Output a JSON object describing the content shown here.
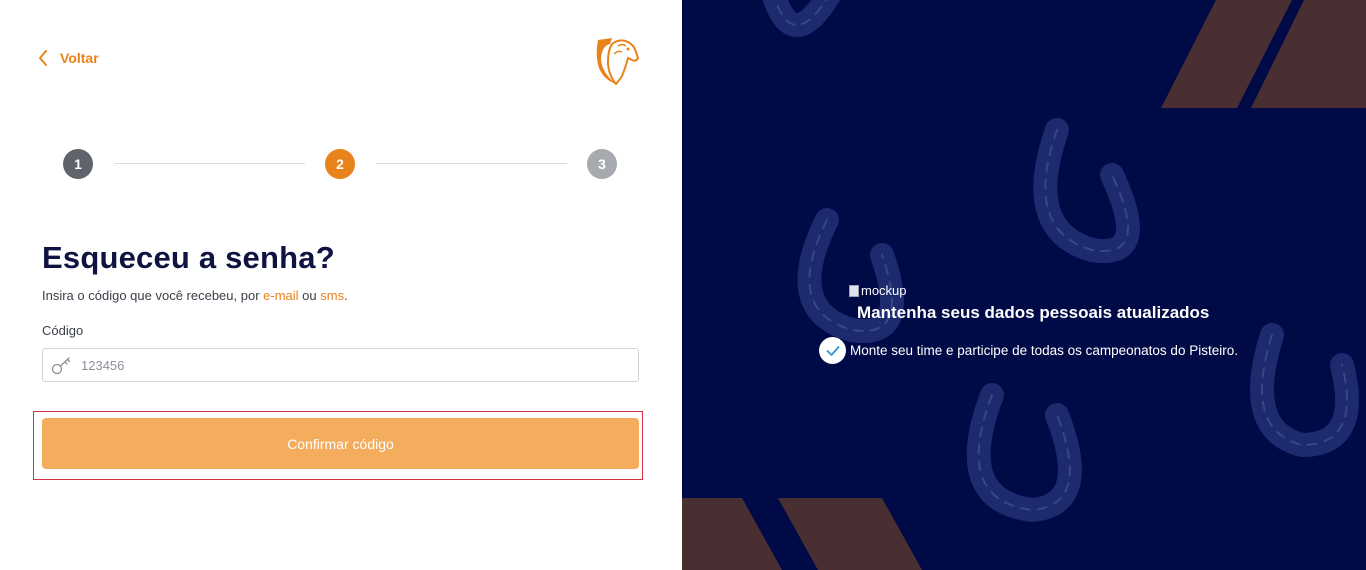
{
  "back": {
    "label": "Voltar"
  },
  "stepper": {
    "steps": [
      {
        "number": "1",
        "state": "done",
        "color": "#5f636b"
      },
      {
        "number": "2",
        "state": "active",
        "color": "#e8831c"
      },
      {
        "number": "3",
        "state": "pending",
        "color": "#a6a9ae"
      }
    ]
  },
  "form": {
    "title": "Esqueceu a senha?",
    "subtitle_prefix": "Insira o código que você recebeu, por ",
    "subtitle_link_email": "e-mail",
    "subtitle_middle": " ou ",
    "subtitle_link_sms": "sms",
    "subtitle_suffix": ".",
    "code_label": "Código",
    "code_placeholder": "123456",
    "code_value": "",
    "code_icon": "key-icon",
    "submit_label": "Confirmar código"
  },
  "promo": {
    "image_alt": "mockup",
    "title": "Mantenha seus dados pessoais atualizados",
    "feature_text": "Monte seu time e participe de todas os campeonatos do Pisteiro.",
    "feature_icon": "check-icon"
  },
  "colors": {
    "accent": "#e8831c",
    "button": "#f4ac5d",
    "title": "#0f1342",
    "panel_bg": "#000a46",
    "stripe": "#4a2f32",
    "focus_outline": "#d5323d"
  }
}
